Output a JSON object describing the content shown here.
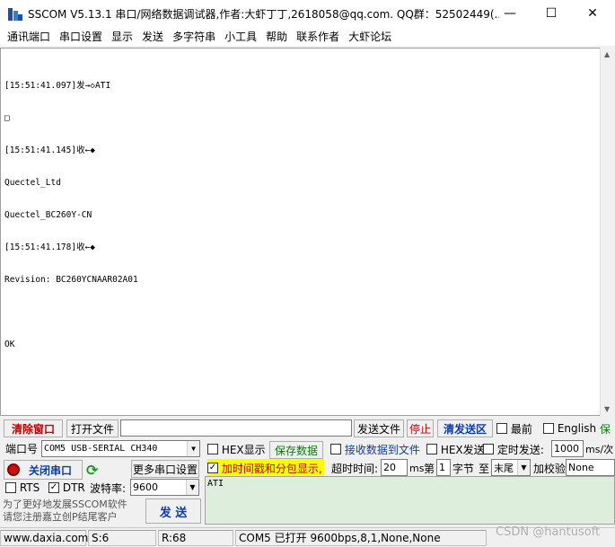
{
  "window": {
    "title": "SSCOM V5.13.1 串口/网络数据调试器,作者:大虾丁丁,2618058@qq.com. QQ群：52502449(...",
    "minimize": "—",
    "maximize": "☐",
    "close": "✕"
  },
  "menu": {
    "items": [
      "通讯端口",
      "串口设置",
      "显示",
      "发送",
      "多字符串",
      "小工具",
      "帮助",
      "联系作者",
      "大虾论坛"
    ]
  },
  "receive_log": {
    "lines": [
      "",
      "[15:51:41.097]发→◇ATI",
      "□",
      "[15:51:41.145]收←◆",
      "Quectel_Ltd",
      "Quectel_BC260Y-CN",
      "[15:51:41.178]收←◆",
      "Revision: BC260YCNAAR02A01",
      "",
      "OK"
    ]
  },
  "toolbar": {
    "clear_window": "清除窗口",
    "open_file": "打开文件",
    "send_file": "发送文件",
    "stop": "停止",
    "clear_send": "清发送区",
    "topmost": "最前",
    "english": "English",
    "save_partial": "保"
  },
  "port": {
    "label": "端口号",
    "value": "COM5 USB-SERIAL CH340",
    "close_port": "关闭串口",
    "more_settings": "更多串口设置",
    "rts": "RTS",
    "dtr": "DTR",
    "baud_label": "波特率:",
    "baud_value": "9600"
  },
  "options": {
    "hex_display": "HEX显示",
    "save_data": "保存数据",
    "recv_to_file": "接收数据到文件",
    "hex_send": "HEX发送",
    "timed_send": "定时发送:",
    "timed_value": "1000",
    "timed_unit": "ms/次",
    "timestamp": "加时间戳和分包显示,",
    "timeout_label": "超时时间:",
    "timeout_value": "20",
    "timeout_unit": "ms",
    "nth_label": "第",
    "nth_value": "1",
    "byte_label": "字节",
    "to_label": "至",
    "to_value": "末尾",
    "checksum_label": "加校验",
    "checksum_value": "None"
  },
  "send": {
    "text": "ATI",
    "button": "发 送",
    "promo_line1": "为了更好地发展SSCOM软件",
    "promo_line2": "请您注册嘉立创P结尾客户"
  },
  "statusbar": {
    "website": "www.daxia.com",
    "sent": "S:6",
    "received": "R:68",
    "port_status": "COM5 已打开  9600bps,8,1,None,None"
  },
  "watermark": "CSDN @hantusoft"
}
